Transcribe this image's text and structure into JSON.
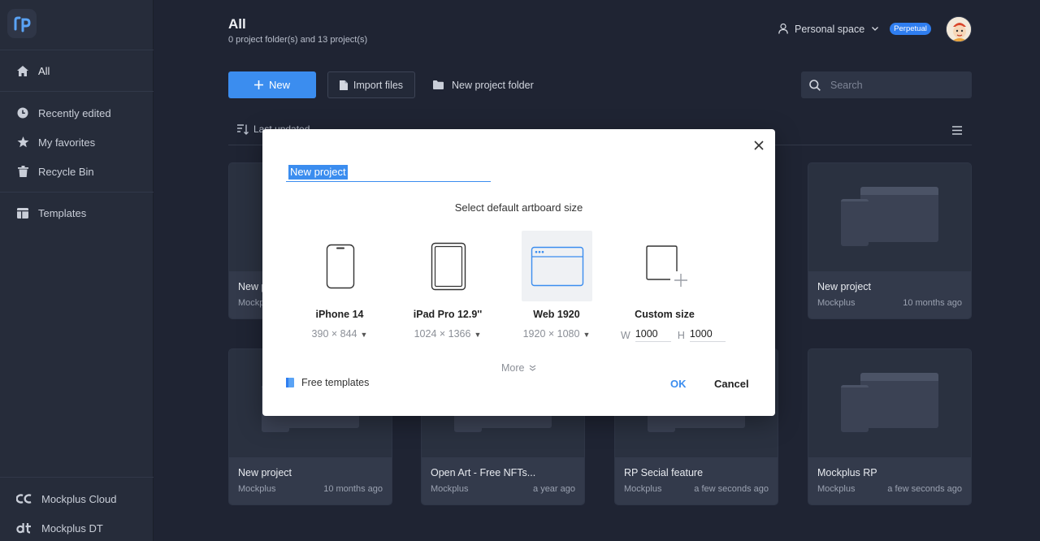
{
  "sidebar": {
    "logo_text": "rp",
    "items": [
      {
        "label": "All",
        "icon": "home-icon"
      },
      {
        "label": "Recently edited",
        "icon": "clock-icon"
      },
      {
        "label": "My favorites",
        "icon": "star-icon"
      },
      {
        "label": "Recycle Bin",
        "icon": "trash-icon"
      },
      {
        "label": "Templates",
        "icon": "templates-icon"
      }
    ],
    "bottom": [
      {
        "label": "Mockplus Cloud",
        "icon": "mockplus-cloud-icon"
      },
      {
        "label": "Mockplus DT",
        "icon": "mockplus-dt-icon"
      }
    ]
  },
  "header": {
    "title": "All",
    "subtitle": "0 project folder(s) and 13 project(s)",
    "space_label": "Personal space",
    "badge": "Perpetual"
  },
  "toolbar": {
    "new_label": "New",
    "import_label": "Import files",
    "folder_label": "New project folder",
    "search_placeholder": "Search"
  },
  "sort": {
    "label": "Last updated"
  },
  "cards": [
    {
      "name": "New p",
      "owner": "Mockp",
      "time": ""
    },
    {
      "name": "New project",
      "owner": "Mockplus",
      "time": "10 months ago"
    },
    {
      "name": "New project",
      "owner": "Mockplus",
      "time": "10 months ago"
    },
    {
      "name": "Open Art - Free NFTs...",
      "owner": "Mockplus",
      "time": "a year ago"
    },
    {
      "name": "RP Secial feature",
      "owner": "Mockplus",
      "time": "a few seconds ago"
    },
    {
      "name": "Mockplus RP",
      "owner": "Mockplus",
      "time": "a few seconds ago"
    }
  ],
  "modal": {
    "project_name": "New project",
    "size_title": "Select default artboard size",
    "options": [
      {
        "label": "iPhone 14",
        "size": "390 × 844",
        "icon": "phone-icon"
      },
      {
        "label": "iPad Pro 12.9''",
        "size": "1024 × 1366",
        "icon": "tablet-icon"
      },
      {
        "label": "Web 1920",
        "size": "1920 × 1080",
        "icon": "browser-window-icon"
      },
      {
        "label": "Custom size",
        "icon": "custom-size-icon"
      }
    ],
    "custom": {
      "w_label": "W",
      "w_value": "1000",
      "h_label": "H",
      "h_value": "1000"
    },
    "more_label": "More",
    "free_templates": "Free templates",
    "ok": "OK",
    "cancel": "Cancel"
  },
  "colors": {
    "accent": "#3b8def",
    "background": "#1f2433",
    "sidebar": "#262c3a"
  }
}
